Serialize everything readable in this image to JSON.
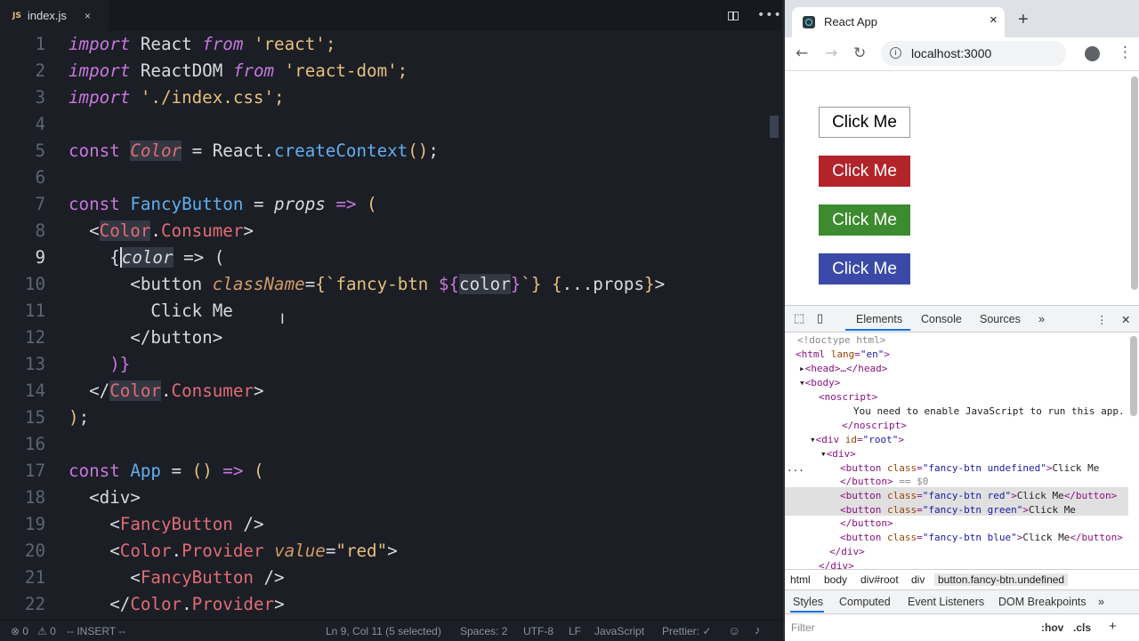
{
  "editor": {
    "tab_js_badge": "JS",
    "tab_filename": "index.js",
    "tab_close": "×",
    "more_icon": "•••",
    "lines": [
      {
        "n": "1"
      },
      {
        "n": "2"
      },
      {
        "n": "3"
      },
      {
        "n": "4"
      },
      {
        "n": "5"
      },
      {
        "n": "6"
      },
      {
        "n": "7"
      },
      {
        "n": "8"
      },
      {
        "n": "9"
      },
      {
        "n": "10"
      },
      {
        "n": "11"
      },
      {
        "n": "12"
      },
      {
        "n": "13"
      },
      {
        "n": "14"
      },
      {
        "n": "15"
      },
      {
        "n": "16"
      },
      {
        "n": "17"
      },
      {
        "n": "18"
      },
      {
        "n": "19"
      },
      {
        "n": "20"
      },
      {
        "n": "21"
      },
      {
        "n": "22"
      }
    ],
    "code": {
      "l1": [
        "import",
        " React ",
        "from",
        " 'react';"
      ],
      "l2": [
        "import",
        " ReactDOM ",
        "from",
        " 'react-dom';"
      ],
      "l3": [
        "import",
        " './index.css';"
      ],
      "l5": [
        "const ",
        "Color",
        " = React.",
        "createContext",
        "(",
        ")",
        ";"
      ],
      "l7": [
        "const ",
        "FancyButton",
        " = ",
        "props",
        " => ",
        "("
      ],
      "l8": [
        "  <",
        "Color",
        ".",
        "Consumer",
        ">"
      ],
      "l9": [
        "    {",
        "color",
        " => ("
      ],
      "l10": [
        "      <",
        "button",
        " ",
        "className",
        "=",
        "{",
        "`fancy-btn ",
        "${",
        "color",
        "}",
        "`",
        "}",
        " {",
        "...",
        "props",
        "}",
        ">"
      ],
      "l11": [
        "        Click Me"
      ],
      "l12": [
        "      </",
        "button",
        ">"
      ],
      "l13": [
        "    )",
        "}"
      ],
      "l14": [
        "  </",
        "Color",
        ".",
        "Consumer",
        ">"
      ],
      "l15": [
        ")",
        ";"
      ],
      "l17": [
        "const ",
        "App",
        " = ",
        "(",
        ")",
        " => ",
        "("
      ],
      "l18": [
        "  <",
        "div",
        ">"
      ],
      "l19": [
        "    <",
        "FancyButton",
        " />"
      ],
      "l20": [
        "    <",
        "Color",
        ".",
        "Provider",
        " ",
        "value",
        "=",
        "\"red\"",
        ">"
      ],
      "l21": [
        "      <",
        "FancyButton",
        " />"
      ],
      "l22": [
        "    </",
        "Color",
        ".",
        "Provider",
        ">"
      ]
    },
    "status": {
      "errors": "⊗ 0",
      "warnings": "⚠ 0",
      "mode": "-- INSERT --",
      "position": "Ln 9, Col 11 (5 selected)",
      "spaces": "Spaces: 2",
      "encoding": "UTF-8",
      "eol": "LF",
      "language": "JavaScript",
      "prettier": "Prettier: ✓"
    }
  },
  "browser": {
    "tab_title": "React App",
    "tab_close": "×",
    "new_tab": "+",
    "url": "localhost:3000",
    "buttons": [
      {
        "label": "Click Me",
        "bg": "#ffffff",
        "fg": "#000000",
        "border": "#9a9a9a"
      },
      {
        "label": "Click Me",
        "bg": "#b3232a",
        "fg": "#ffffff",
        "border": "#b3232a"
      },
      {
        "label": "Click Me",
        "bg": "#3d8b2f",
        "fg": "#ffffff",
        "border": "#3d8b2f"
      },
      {
        "label": "Click Me",
        "bg": "#3b4aa8",
        "fg": "#ffffff",
        "border": "#3b4aa8"
      }
    ],
    "devtools": {
      "tabs": [
        "Elements",
        "Console",
        "Sources",
        "»"
      ],
      "dom": {
        "doctype": "<!doctype html>",
        "html_open": "<html ",
        "html_attr": "lang",
        "html_val": "\"en\"",
        "html_close": ">",
        "head": "<head>…</head>",
        "body": "<body>",
        "noscript_open": "<noscript>",
        "noscript_text": "You need to enable JavaScript to run this app.",
        "noscript_close": "</noscript>",
        "root_open": "<div ",
        "root_attr": "id",
        "root_val": "\"root\"",
        "root_close": ">",
        "div_open": "<div>",
        "btn_open": "<button ",
        "btn_attr": "class",
        "btn1_val": "\"fancy-btn undefined\"",
        "btn2_val": "\"fancy-btn red\"",
        "btn3_val": "\"fancy-btn green\"",
        "btn4_val": "\"fancy-btn blue\"",
        "btn_text": "Click Me",
        "btn_end": "</button>",
        "eq_ref": " == $0",
        "div_close": "</div>",
        "ellipsis": "..."
      },
      "breadcrumbs": [
        "html",
        "body",
        "div#root",
        "div",
        "button.fancy-btn.undefined"
      ],
      "style_tabs": [
        "Styles",
        "Computed",
        "Event Listeners",
        "DOM Breakpoints",
        "»"
      ],
      "filter_placeholder": "Filter",
      "hov": ":hov",
      "cls": ".cls",
      "plus": "+"
    }
  }
}
